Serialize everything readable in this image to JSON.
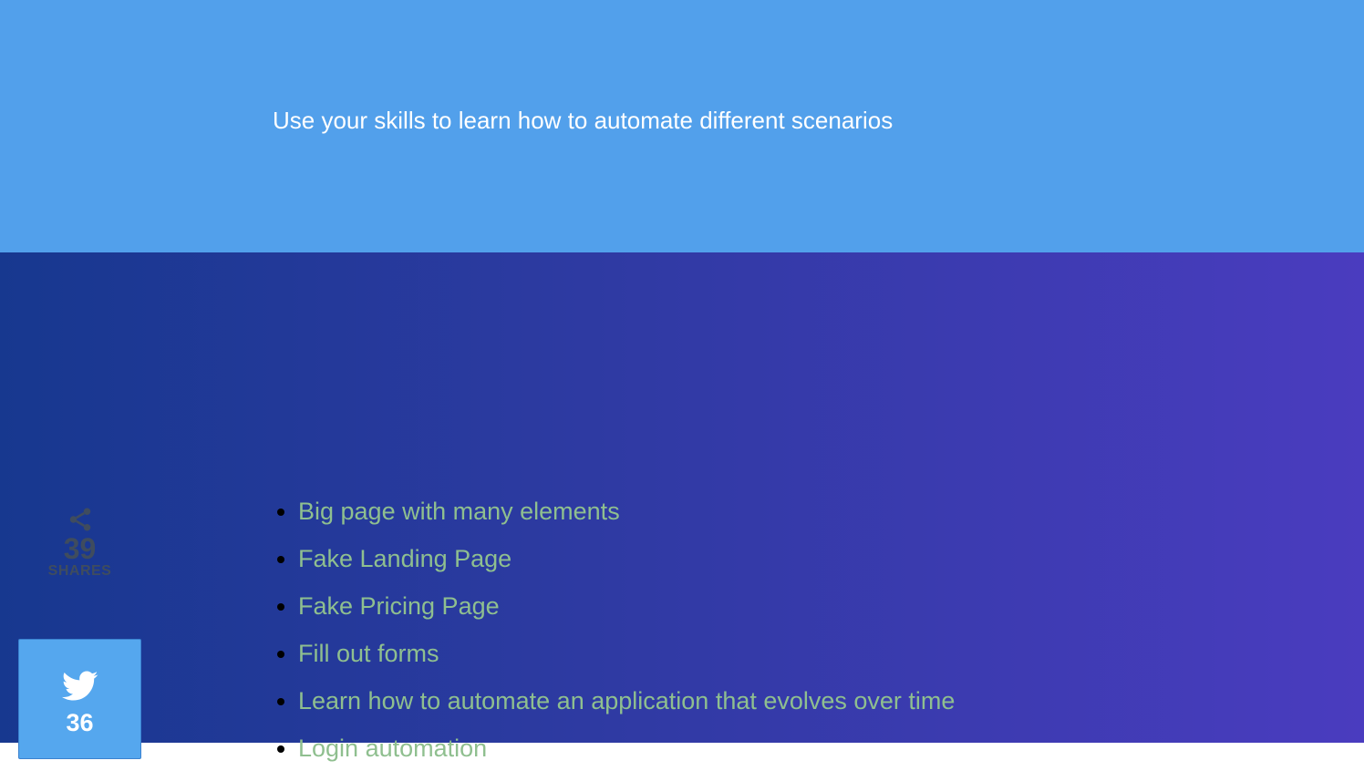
{
  "hero": {
    "subtitle": "Use your skills to learn how to automate different scenarios"
  },
  "links": [
    {
      "label": "Big page with many elements"
    },
    {
      "label": "Fake Landing Page"
    },
    {
      "label": "Fake Pricing Page"
    },
    {
      "label": "Fill out forms"
    },
    {
      "label": "Learn how to automate an application that evolves over time"
    },
    {
      "label": "Login automation"
    }
  ],
  "share": {
    "icon": "share-icon",
    "count": "39",
    "label": "SHARES"
  },
  "twitter": {
    "icon": "twitter-icon",
    "count": "36"
  },
  "colors": {
    "hero_bg": "#52a0eb",
    "gradient_start": "#17388f",
    "gradient_end": "#4a3cbf",
    "link_text": "#8fbf8f",
    "twitter_bg": "#55a7ee"
  }
}
